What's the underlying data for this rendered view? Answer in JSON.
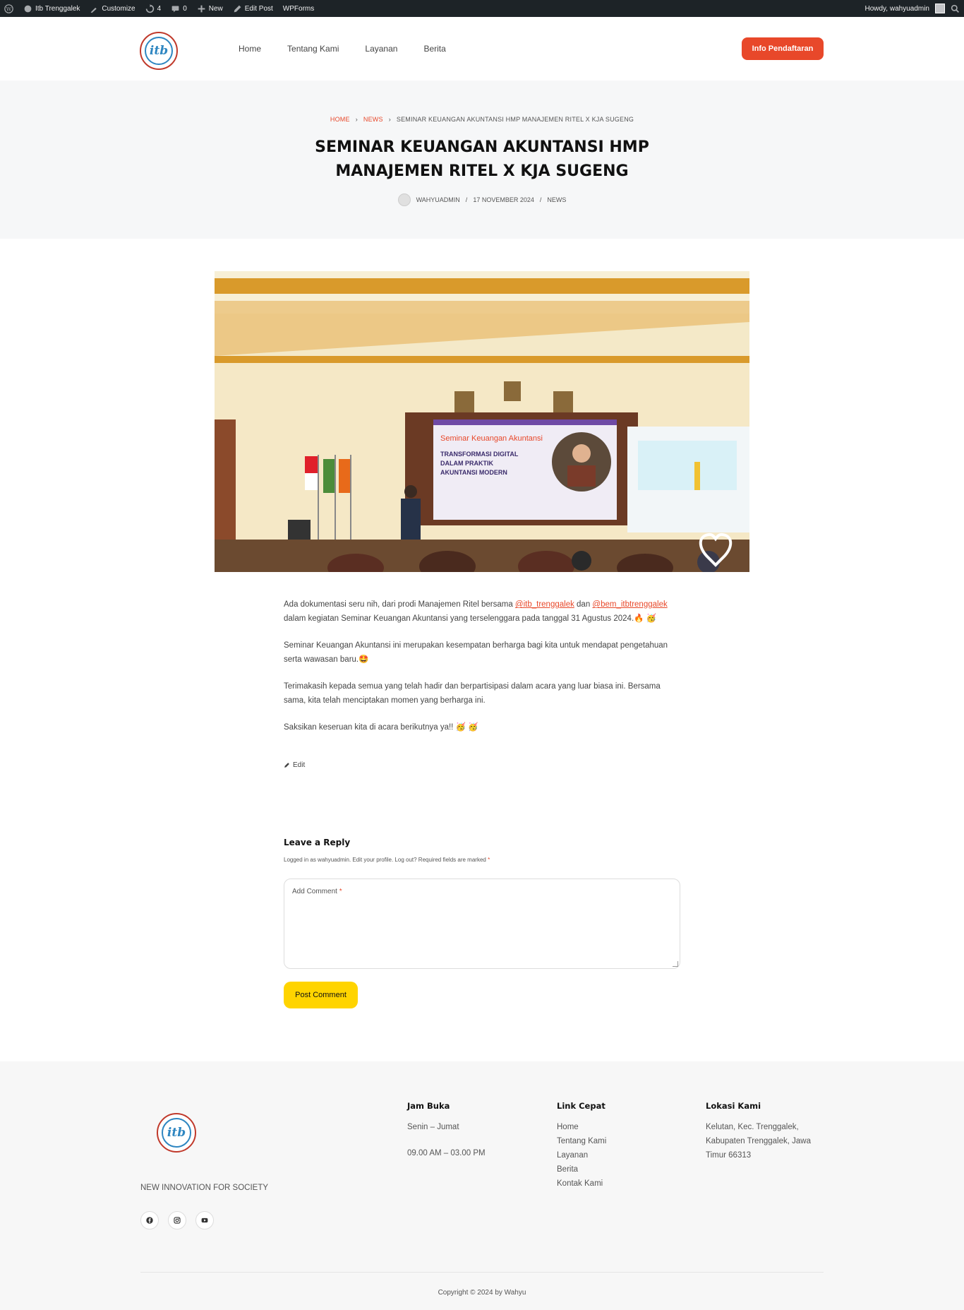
{
  "adminbar": {
    "site": "Itb Trenggalek",
    "customize": "Customize",
    "updates": "4",
    "comments": "0",
    "new": "New",
    "edit_post": "Edit Post",
    "wpforms": "WPForms",
    "howdy": "Howdy, wahyuadmin"
  },
  "logo": {
    "text": "itb"
  },
  "nav": [
    "Home",
    "Tentang Kami",
    "Layanan",
    "Berita"
  ],
  "cta": "Info Pendaftaran",
  "breadcrumb": {
    "home": "HOME",
    "news": "NEWS",
    "current": "SEMINAR KEUANGAN AKUNTANSI HMP MANAJEMEN RITEL X KJA SUGENG"
  },
  "post": {
    "title_line1": "SEMINAR KEUANGAN AKUNTANSI HMP",
    "title_line2": "MANAJEMEN RITEL X KJA SUGENG",
    "author": "WAHYUADMIN",
    "date": "17 NOVEMBER 2024",
    "category": "NEWS",
    "sep": "/"
  },
  "image": {
    "banner_title": "Seminar Keuangan Akuntansi",
    "banner_l1": "TRANSFORMASI DIGITAL",
    "banner_l2": "DALAM PRAKTIK",
    "banner_l3": "AKUNTANSI MODERN"
  },
  "article": {
    "p1_a": "Ada dokumentasi seru nih, dari prodi Manajemen Ritel bersama ",
    "mention1": "@itb_trenggalek",
    "p1_b": " dan ",
    "mention2": "@bem_itbtrenggalek",
    "p1_c": " dalam kegiatan Seminar Keuangan Akuntansi yang terselenggara pada tanggal 31 Agustus 2024.🔥 🥳",
    "p2": "Seminar Keuangan Akuntansi ini merupakan kesempatan berharga bagi kita untuk mendapat pengetahuan serta wawasan baru.🤩",
    "p3": "Terimakasih kepada semua yang telah hadir dan berpartisipasi dalam acara yang luar biasa ini. Bersama sama, kita telah menciptakan momen yang berharga ini.",
    "p4": "Saksikan keseruan kita di acara berikutnya ya!! 🥳 🥳",
    "edit": "Edit"
  },
  "comments": {
    "title": "Leave a Reply",
    "logged_in": "Logged in as wahyuadmin. Edit your profile. Log out? Required fields are marked ",
    "req": "*",
    "field_label": "Add Comment ",
    "button": "Post Comment"
  },
  "footer": {
    "tagline": "NEW INNOVATION FOR SOCIETY",
    "hours_title": "Jam Buka",
    "days": "Senin – Jumat",
    "time": "09.00 AM – 03.00 PM",
    "links_title": "Link Cepat",
    "links": [
      "Home",
      "Tentang Kami",
      "Layanan",
      "Berita",
      "Kontak Kami"
    ],
    "location_title": "Lokasi Kami",
    "address_l1": "Kelutan, Kec. Trenggalek,",
    "address_l2": "Kabupaten Trenggalek, Jawa",
    "address_l3": "Timur 66313",
    "copyright": "Copyright © 2024 by Wahyu"
  },
  "colors": {
    "accent": "#e8482a",
    "button_yellow": "#ffd400",
    "adminbar": "#1d2327"
  }
}
